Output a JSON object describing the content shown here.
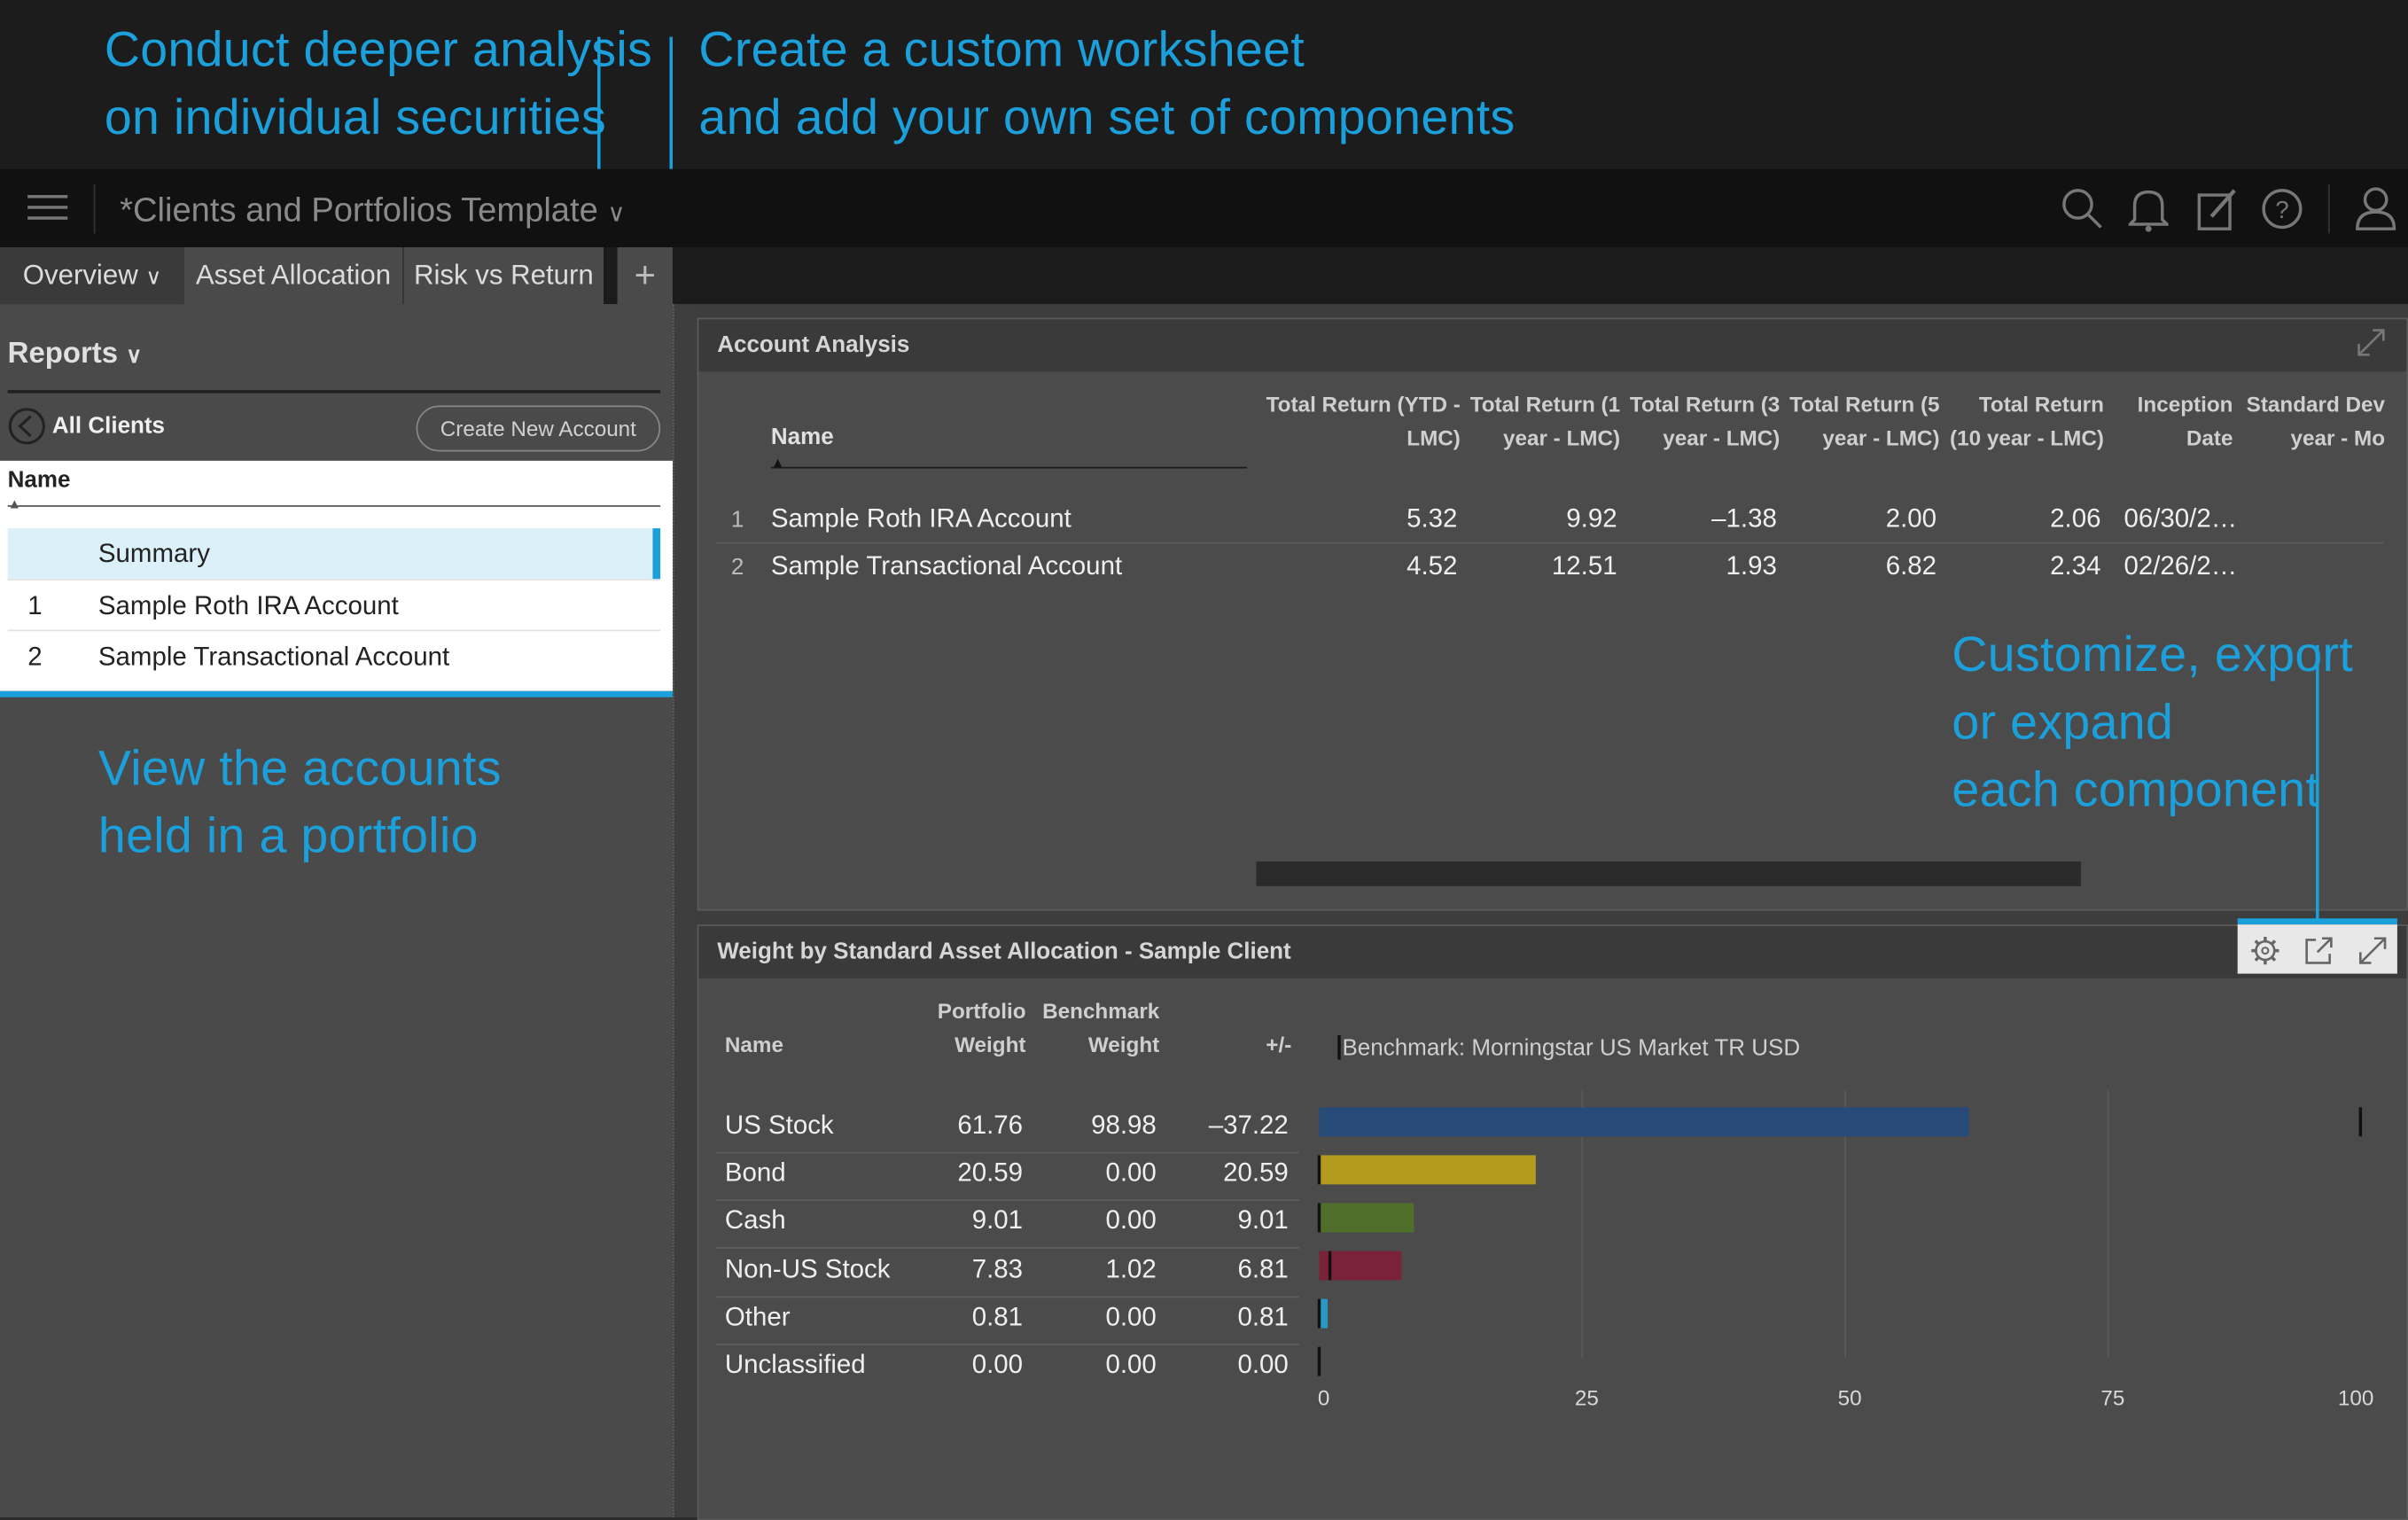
{
  "callouts": {
    "top_left": [
      "Conduct deeper analysis",
      "on individual securities"
    ],
    "top_mid": [
      "Create a custom worksheet",
      "and add your own set of components"
    ],
    "left_mid": [
      "View the accounts",
      "held in a portfolio"
    ],
    "right_mid": [
      "Customize, export",
      "or expand",
      "each component"
    ]
  },
  "header": {
    "title": "*Clients and Portfolios Template",
    "icons": [
      "menu-icon",
      "search-icon",
      "bell-icon",
      "edit-icon",
      "help-icon",
      "user-icon"
    ]
  },
  "tabs": [
    {
      "label": "Overview"
    },
    {
      "label": "Asset Allocation"
    },
    {
      "label": "Risk vs Return"
    },
    {
      "label": "+"
    }
  ],
  "left": {
    "reports_label": "Reports",
    "all_clients": "All Clients",
    "create_button": "Create New Account",
    "name_header": "Name",
    "rows": [
      {
        "idx": "",
        "name": "Summary"
      },
      {
        "idx": "1",
        "name": "Sample Roth IRA Account"
      },
      {
        "idx": "2",
        "name": "Sample Transactional Account"
      }
    ]
  },
  "account_analysis": {
    "title": "Account Analysis",
    "name_header": "Name",
    "headers": [
      [
        "Total Return (YTD -",
        "LMC)"
      ],
      [
        "Total Return (1",
        "year - LMC)"
      ],
      [
        "Total Return (3",
        "year - LMC)"
      ],
      [
        "Total Return (5",
        "year - LMC)"
      ],
      [
        "Total Return",
        "(10 year - LMC)"
      ],
      [
        "Inception",
        "Date"
      ],
      [
        "Standard Dev",
        "year - Mo"
      ]
    ],
    "rows": [
      {
        "idx": "1",
        "name": "Sample Roth IRA Account",
        "vals": [
          "5.32",
          "9.92",
          "–1.38",
          "2.00",
          "2.06",
          "06/30/2…",
          ""
        ]
      },
      {
        "idx": "2",
        "name": "Sample Transactional Account",
        "vals": [
          "4.52",
          "12.51",
          "1.93",
          "6.82",
          "2.34",
          "02/26/2…",
          ""
        ]
      }
    ]
  },
  "weight": {
    "title": "Weight by Standard Asset Allocation - Sample Client",
    "headers": {
      "name": "Name",
      "portfolio": [
        "Portfolio",
        "Weight"
      ],
      "benchmark": [
        "Benchmark",
        "Weight"
      ],
      "diff": "+/-"
    },
    "benchmark_label": "Benchmark: Morningstar US Market TR USD",
    "rows": [
      {
        "name": "US Stock",
        "portfolio": "61.76",
        "benchmark": "98.98",
        "diff": "–37.22"
      },
      {
        "name": "Bond",
        "portfolio": "20.59",
        "benchmark": "0.00",
        "diff": "20.59"
      },
      {
        "name": "Cash",
        "portfolio": "9.01",
        "benchmark": "0.00",
        "diff": "9.01"
      },
      {
        "name": "Non-US Stock",
        "portfolio": "7.83",
        "benchmark": "1.02",
        "diff": "6.81"
      },
      {
        "name": "Other",
        "portfolio": "0.81",
        "benchmark": "0.00",
        "diff": "0.81"
      },
      {
        "name": "Unclassified",
        "portfolio": "0.00",
        "benchmark": "0.00",
        "diff": "0.00"
      }
    ]
  },
  "chart_data": {
    "type": "bar",
    "categories": [
      "US Stock",
      "Bond",
      "Cash",
      "Non-US Stock",
      "Other",
      "Unclassified"
    ],
    "series": [
      {
        "name": "Portfolio Weight",
        "values": [
          61.76,
          20.59,
          9.01,
          7.83,
          0.81,
          0.0
        ]
      },
      {
        "name": "Benchmark Weight",
        "values": [
          98.98,
          0.0,
          0.0,
          1.02,
          0.0,
          0.0
        ]
      }
    ],
    "colors": [
      "#284a78",
      "#b49a1e",
      "#4e6e2a",
      "#7a2238",
      "#2a98c2",
      "#555555"
    ],
    "xticks": [
      "0",
      "25",
      "50",
      "75",
      "100"
    ],
    "xlim": [
      0,
      100
    ],
    "orientation": "horizontal"
  },
  "accent_color": "#1ba0dc"
}
